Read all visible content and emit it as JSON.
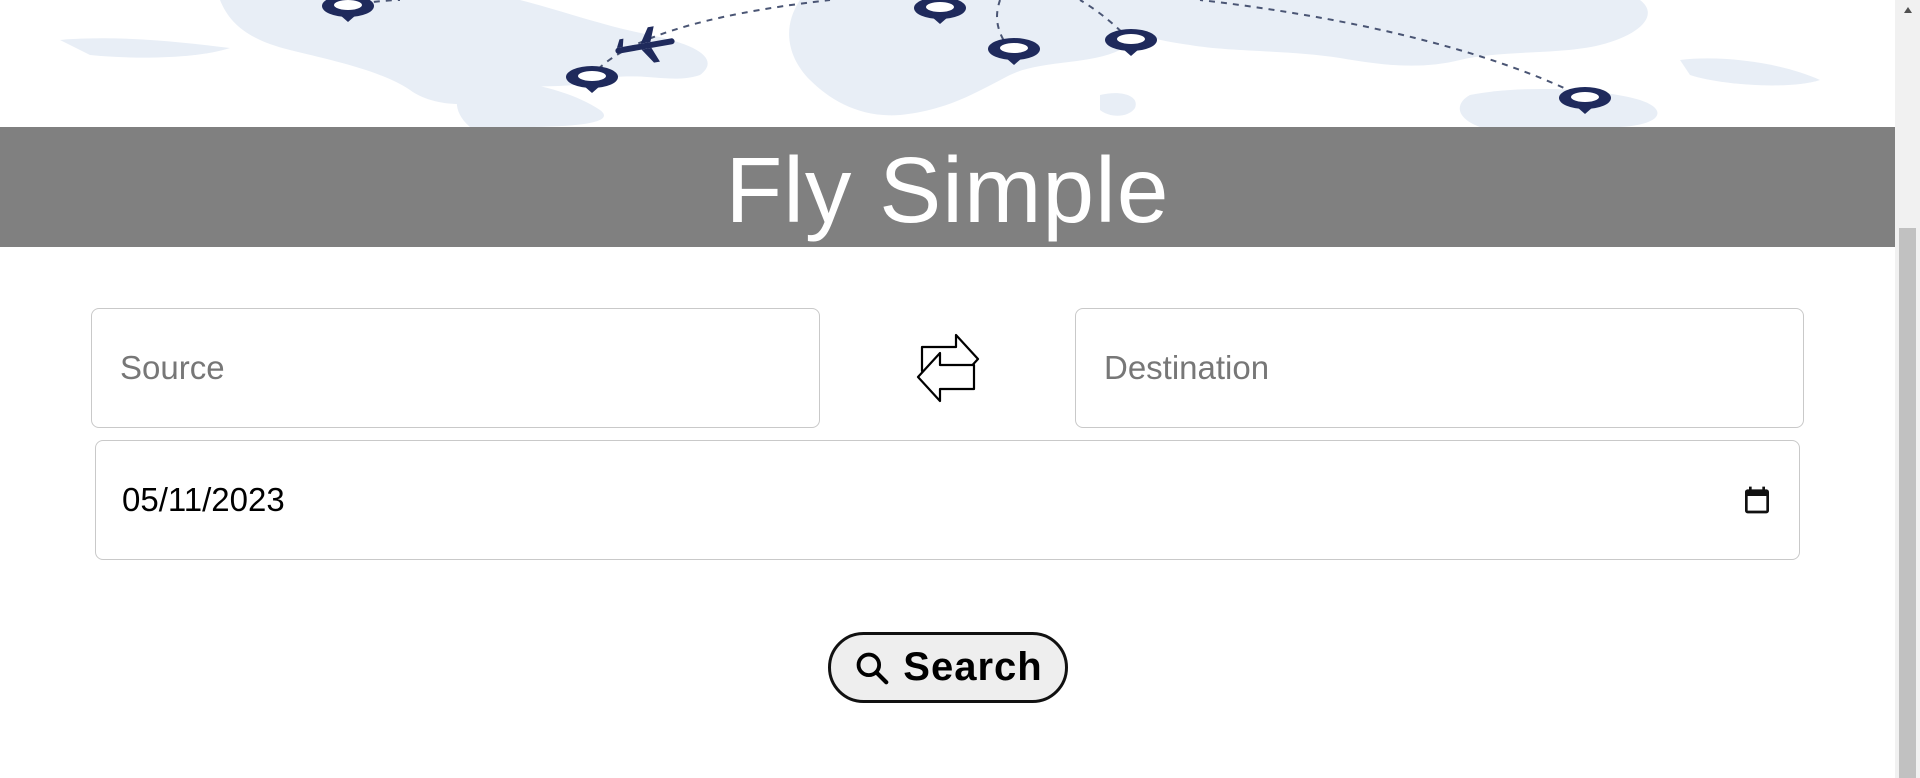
{
  "hero": {
    "title": "Fly Simple"
  },
  "form": {
    "source_placeholder": "Source",
    "destination_placeholder": "Destination",
    "date_value": "05/11/2023",
    "search_label": "Search"
  },
  "icons": {
    "swap": "swap-arrows-icon",
    "calendar": "calendar-icon",
    "search": "magnifier-icon",
    "plane": "airplane-icon",
    "pin": "location-pin-icon"
  },
  "colors": {
    "title_bar": "#808080",
    "title_text": "#ffffff",
    "map_land": "#e8eef6",
    "map_pin": "#1f2a5c",
    "button_bg": "#eeeeee"
  }
}
